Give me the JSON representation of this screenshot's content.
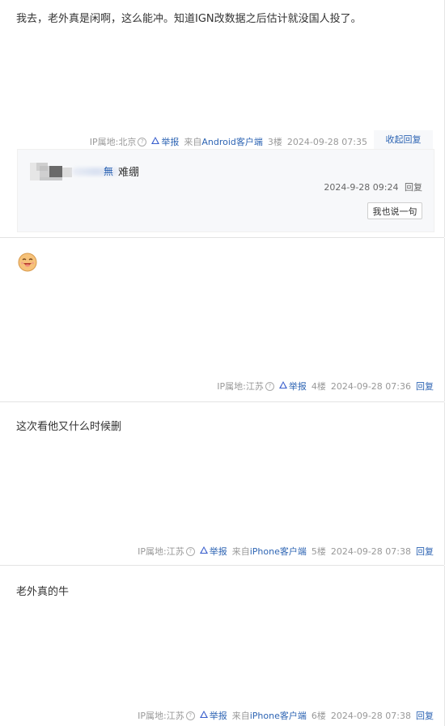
{
  "posts": [
    {
      "content": "我去，老外真是闲啊，这么能冲。知道IGN改数据之后估计就没国人投了。",
      "ip_label": "IP属地:北京",
      "report": "举报",
      "source_prefix": "来自",
      "source": "Android客户端",
      "floor": "3楼",
      "time": "2024-09-28 07:35",
      "action": "收起回复",
      "replies": [
        {
          "user": "無",
          "text": "难绷",
          "time": "2024-9-28 09:24",
          "reply": "回复"
        }
      ],
      "say_button": "我也说一句"
    },
    {
      "emoji": "smiling-face-emoji",
      "ip_label": "IP属地:江苏",
      "report": "举报",
      "floor": "4楼",
      "time": "2024-09-28 07:36",
      "action": "回复"
    },
    {
      "content": "这次看他又什么时候删",
      "ip_label": "IP属地:江苏",
      "report": "举报",
      "source_prefix": "来自",
      "source": "iPhone客户端",
      "floor": "5楼",
      "time": "2024-09-28 07:38",
      "action": "回复"
    },
    {
      "content": "老外真的牛",
      "ip_label": "IP属地:江苏",
      "report": "举报",
      "source_prefix": "来自",
      "source": "iPhone客户端",
      "floor": "6楼",
      "time": "2024-09-28 07:38",
      "action": "回复"
    }
  ],
  "colors": {
    "link": "#2d64b3",
    "meta": "#999999",
    "reply_bg": "#f7f8fa"
  }
}
